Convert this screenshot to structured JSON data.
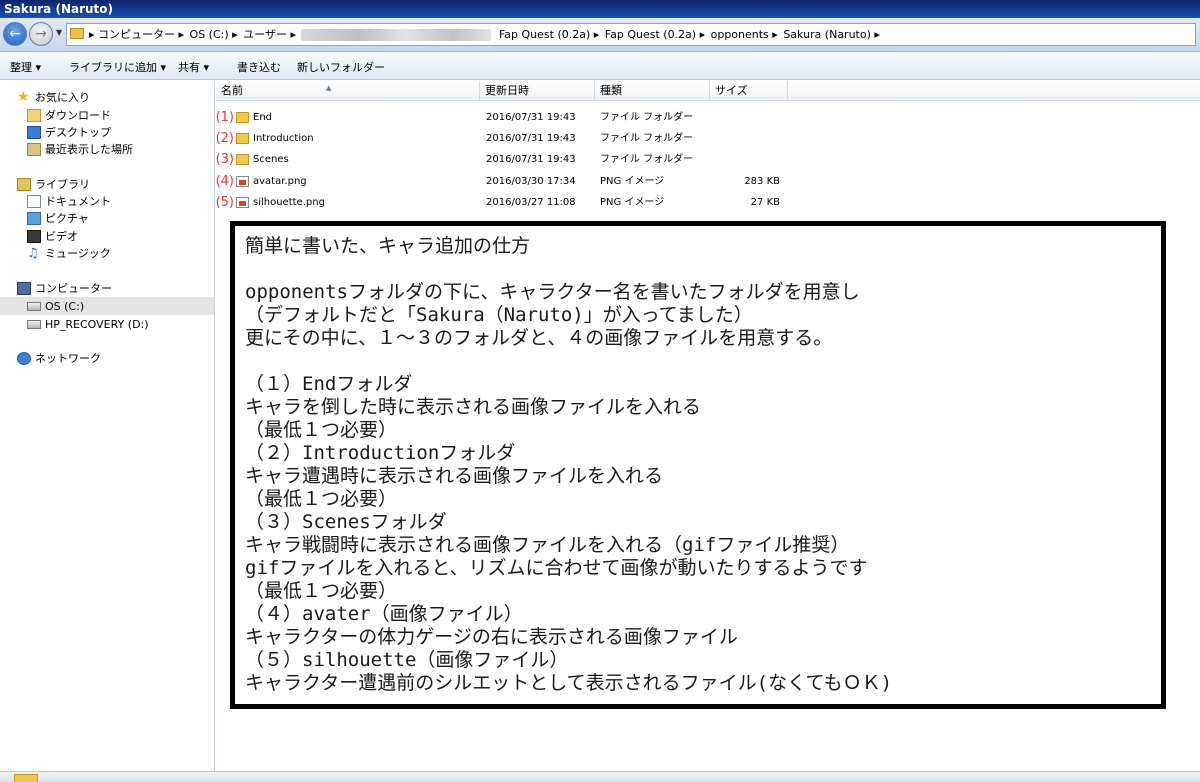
{
  "window": {
    "title": "Sakura (Naruto)"
  },
  "address": {
    "crumbs": [
      "▸ コンピューター ▸",
      "OS (C:) ▸",
      "ユーザー ▸"
    ],
    "crumbs_after": [
      "Fap Quest (0.2a) ▸",
      "Fap Quest (0.2a) ▸",
      "opponents ▸",
      "Sakura (Naruto) ▸"
    ]
  },
  "toolbar": {
    "organize": "整理 ▾",
    "add_to_library": "ライブラリに追加 ▾",
    "share": "共有 ▾",
    "burn": "書き込む",
    "new_folder": "新しいフォルダー"
  },
  "sidebar": {
    "favorites": "お気に入り",
    "downloads": "ダウンロード",
    "desktop": "デスクトップ",
    "recent": "最近表示した場所",
    "libraries": "ライブラリ",
    "documents": "ドキュメント",
    "pictures": "ピクチャ",
    "videos": "ビデオ",
    "music": "ミュージック",
    "computer": "コンピューター",
    "drive_c": "OS (C:)",
    "drive_d": "HP_RECOVERY (D:)",
    "network": "ネットワーク"
  },
  "columns": {
    "name": "名前",
    "date": "更新日時",
    "type": "種類",
    "size": "サイズ"
  },
  "files": [
    {
      "num": "(1)",
      "name": "End",
      "date": "2016/07/31 19:43",
      "type": "ファイル フォルダー",
      "size": ""
    },
    {
      "num": "(2)",
      "name": "Introduction",
      "date": "2016/07/31 19:43",
      "type": "ファイル フォルダー",
      "size": ""
    },
    {
      "num": "(3)",
      "name": "Scenes",
      "date": "2016/07/31 19:43",
      "type": "ファイル フォルダー",
      "size": ""
    },
    {
      "num": "(4)",
      "name": "avatar.png",
      "date": "2016/03/30 17:34",
      "type": "PNG イメージ",
      "size": "283 KB"
    },
    {
      "num": "(5)",
      "name": "silhouette.png",
      "date": "2016/03/27 11:08",
      "type": "PNG イメージ",
      "size": "27 KB"
    }
  ],
  "note": {
    "lines": [
      "簡単に書いた、キャラ追加の仕方",
      "",
      "opponentsフォルダの下に、キャラクター名を書いたフォルダを用意し",
      "（デフォルトだと「Sakura（Naruto)」が入ってました）",
      "更にその中に、１～３のフォルダと、４の画像ファイルを用意する。",
      "",
      "（１）Endフォルダ",
      " キャラを倒した時に表示される画像ファイルを入れる",
      "  （最低１つ必要）",
      "（２）Introductionフォルダ",
      " キャラ遭遇時に表示される画像ファイルを入れる",
      "  （最低１つ必要）",
      "（３）Scenesフォルダ",
      " キャラ戦闘時に表示される画像ファイルを入れる（gifファイル推奨）",
      " gifファイルを入れると、リズムに合わせて画像が動いたりするようです",
      "  （最低１つ必要）",
      "（４）avater（画像ファイル）",
      " キャラクターの体力ゲージの右に表示される画像ファイル",
      "（５）silhouette（画像ファイル）",
      " キャラクター遭遇前のシルエットとして表示されるファイル(なくてもＯＫ)"
    ]
  }
}
